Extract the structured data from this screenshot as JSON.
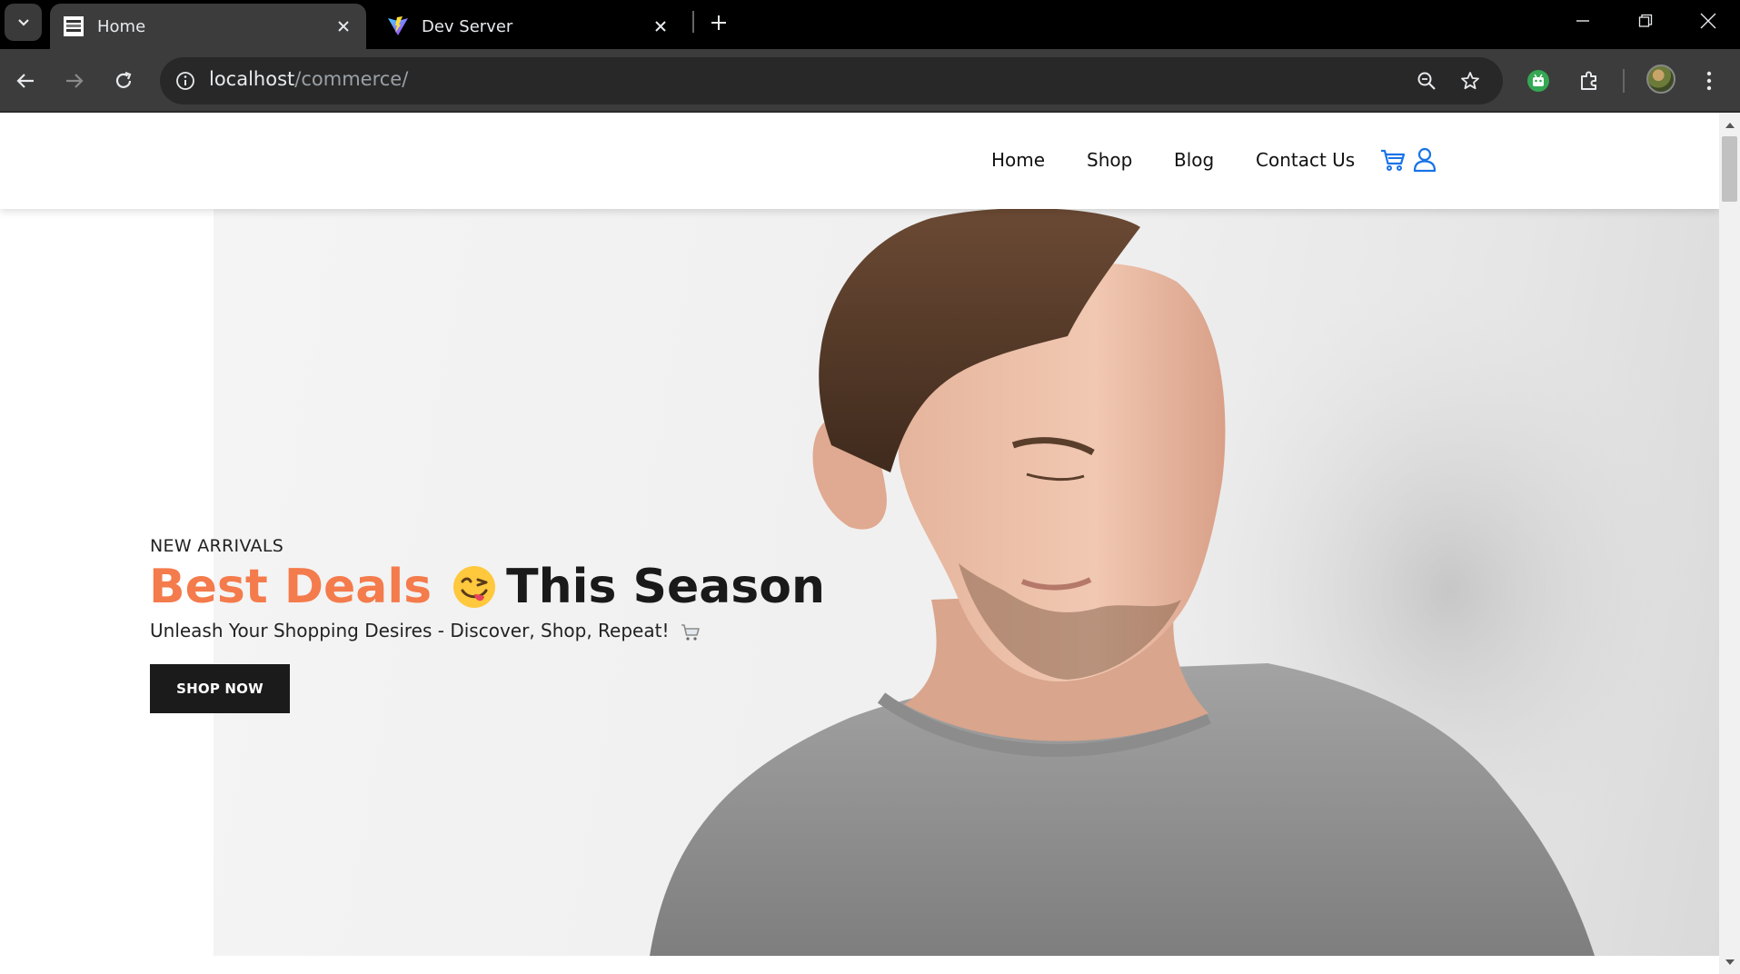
{
  "browser": {
    "tabs": [
      {
        "title": "Home",
        "active": true
      },
      {
        "title": "Dev Server",
        "active": false
      }
    ],
    "url": {
      "host": "localhost",
      "path": "/commerce/"
    }
  },
  "site": {
    "nav": [
      "Home",
      "Shop",
      "Blog",
      "Contact Us"
    ],
    "icons": [
      "cart-icon",
      "user-icon"
    ],
    "accent_color": "#f47b4c",
    "link_icon_color": "#1a73e8"
  },
  "hero": {
    "eyebrow": "NEW ARRIVALS",
    "title_accent": "Best Deals",
    "title_rest": "This Season",
    "subtitle": "Unleash Your Shopping Desires - Discover, Shop, Repeat!",
    "cta": "SHOP NOW"
  }
}
